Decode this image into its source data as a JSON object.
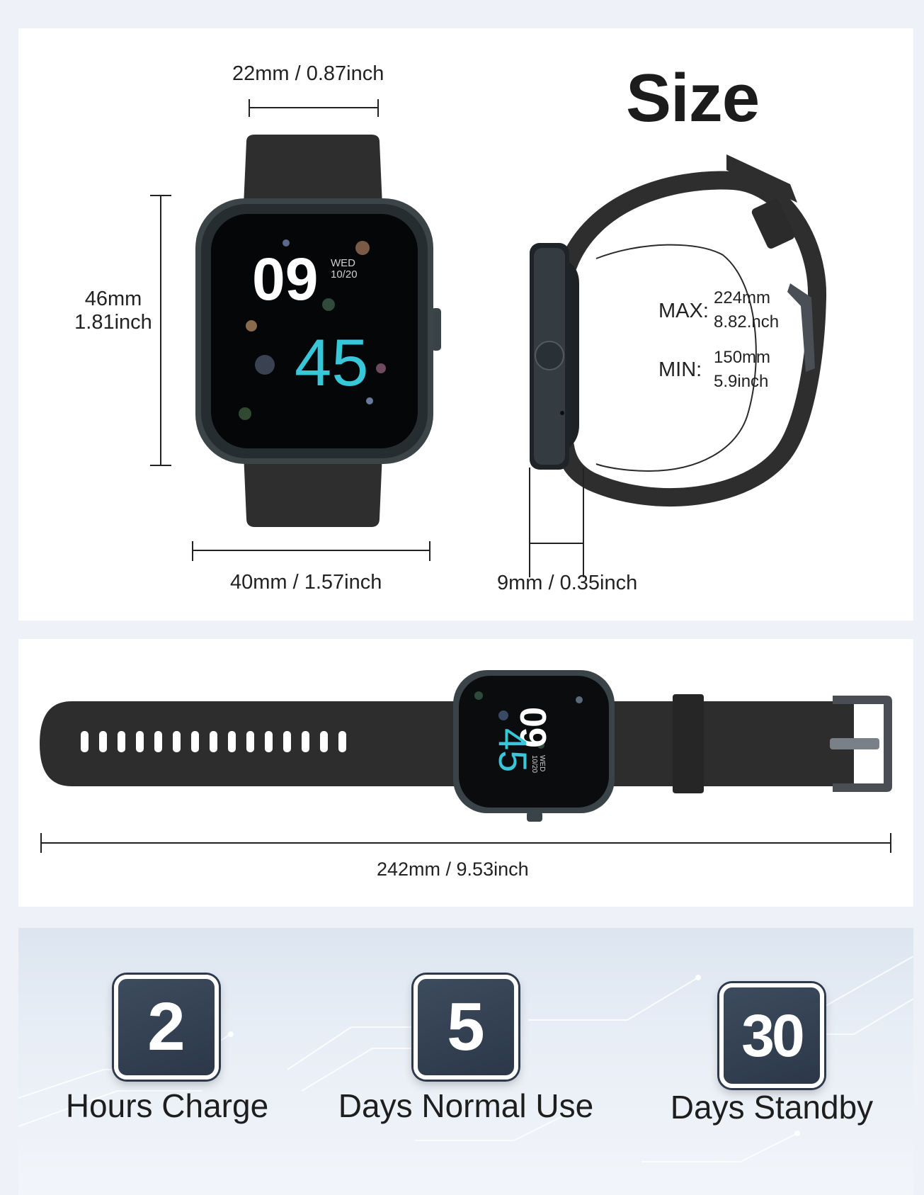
{
  "title": "Size",
  "front": {
    "top_width": "22mm / 0.87inch",
    "height_mm": "46mm",
    "height_inch": "1.81inch",
    "bottom_width": "40mm / 1.57inch",
    "screen": {
      "hour": "09",
      "day": "WED",
      "date": "10/20",
      "minute": "45"
    }
  },
  "side": {
    "thickness": "9mm / 0.35inch",
    "max_label": "MAX:",
    "max_mm": "224mm",
    "max_inch": "8.82.nch",
    "min_label": "MIN:",
    "min_mm": "150mm",
    "min_inch": "5.9inch"
  },
  "band": {
    "length": "242mm / 9.53inch",
    "screen": {
      "hour": "09",
      "day": "WED",
      "date": "10/20",
      "minute": "45"
    }
  },
  "stats": [
    {
      "value": "2",
      "label": "Hours Charge"
    },
    {
      "value": "5",
      "label": "Days Normal Use"
    },
    {
      "value": "30",
      "label": "Days Standby"
    }
  ],
  "colors": {
    "background": "#eef1f7",
    "strap": "#2b2b2b",
    "accent_cyan": "#38c6d9",
    "stat_box": "#33404f"
  }
}
